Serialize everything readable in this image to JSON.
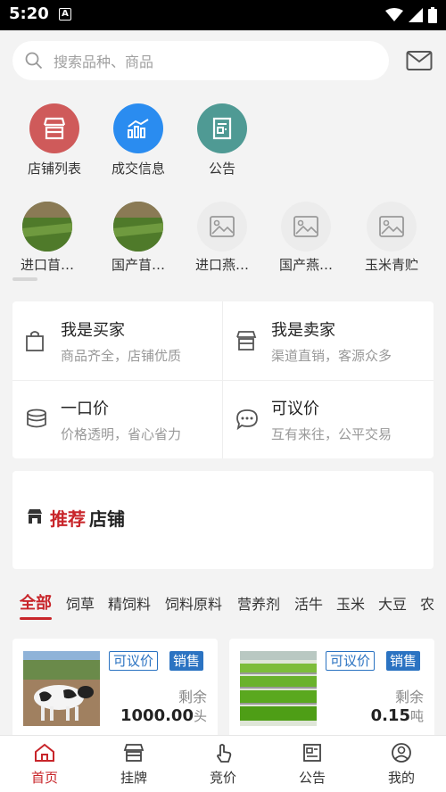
{
  "status": {
    "time": "5:20",
    "badge": "A"
  },
  "search": {
    "placeholder": "搜索品种、商品"
  },
  "quick_links": [
    {
      "label": "店铺列表",
      "icon": "store-icon",
      "color": "#cf5a5a"
    },
    {
      "label": "成交信息",
      "icon": "chart-icon",
      "color": "#2a8cf0"
    },
    {
      "label": "公告",
      "icon": "notice-icon",
      "color": "#4f9a94"
    }
  ],
  "categories": [
    {
      "label": "进口苜…"
    },
    {
      "label": "国产苜…"
    },
    {
      "label": "进口燕…"
    },
    {
      "label": "国产燕…"
    },
    {
      "label": "玉米青贮"
    }
  ],
  "features": [
    {
      "title": "我是买家",
      "subtitle": "商品齐全，店铺优质"
    },
    {
      "title": "我是卖家",
      "subtitle": "渠道直销，客源众多"
    },
    {
      "title": "一口价",
      "subtitle": "价格透明，省心省力"
    },
    {
      "title": "可议价",
      "subtitle": "互有来往，公平交易"
    }
  ],
  "recommend": {
    "highlight": "推荐",
    "rest": "店铺"
  },
  "tabs": [
    "全部",
    "饲草",
    "精饲料",
    "饲料原料",
    "营养剂",
    "活牛",
    "玉米",
    "大豆",
    "农"
  ],
  "products": [
    {
      "badge_price": "可议价",
      "badge_type": "销售",
      "remain_label": "剩余",
      "qty": "1000.00",
      "unit": "头"
    },
    {
      "badge_price": "可议价",
      "badge_type": "销售",
      "remain_label": "剩余",
      "qty": "0.15",
      "unit": "吨"
    }
  ],
  "nav": [
    {
      "label": "首页"
    },
    {
      "label": "挂牌"
    },
    {
      "label": "竞价"
    },
    {
      "label": "公告"
    },
    {
      "label": "我的"
    }
  ],
  "colors": {
    "accent": "#c8252a",
    "blue": "#2b73c2"
  }
}
